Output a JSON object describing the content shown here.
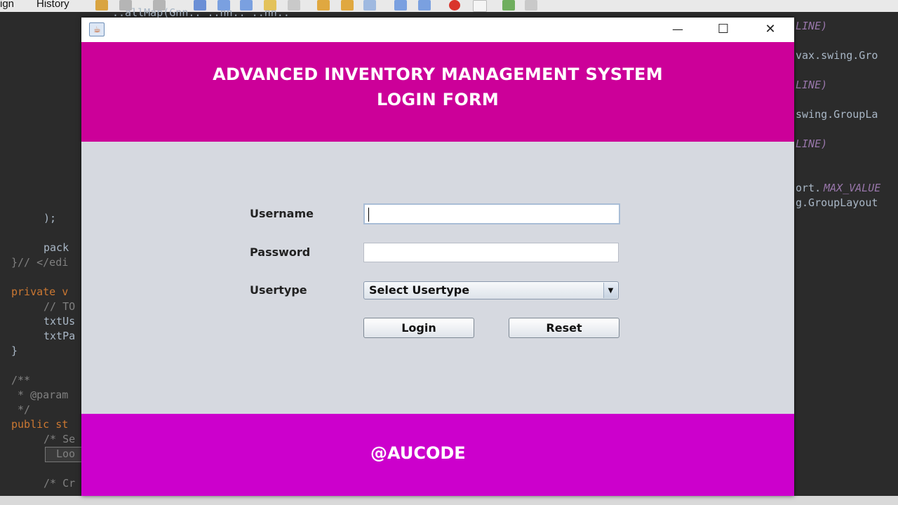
{
  "ide": {
    "menu": [
      "ign",
      "History"
    ],
    "code_left": {
      "l1": ");",
      "l2": "pack",
      "l3": "}// </edi",
      "l4_kw": "private v",
      "l5": "// TO",
      "l6": "txtUs",
      "l7": "txtPa",
      "l8": "}",
      "l9": "/**",
      "l10": " * @param",
      "l11": " */",
      "l12_kw": "public st",
      "l13": "/* Se",
      "l14": "Loo",
      "l15": "/* Cr"
    },
    "code_top": "..allMap(Gnn.. ..nn.. ..nn..",
    "code_right": {
      "r1": "LINE)",
      "r2": "vax.swing.Gro",
      "r3": "LINE)",
      "r4": "swing.GroupLa",
      "r5": "LINE)",
      "r6a": "ort.",
      "r6b": "MAX_VALUE",
      "r7": "g.GroupLayout"
    }
  },
  "window": {
    "icon": "java-coffee-icon",
    "controls": {
      "minimize": "—",
      "maximize": "☐",
      "close": "✕"
    },
    "header": {
      "line1": "ADVANCED INVENTORY MANAGEMENT SYSTEM",
      "line2": "LOGIN FORM"
    },
    "form": {
      "username_label": "Username",
      "username_value": "",
      "password_label": "Password",
      "password_value": "",
      "usertype_label": "Usertype",
      "usertype_selected": "Select Usertype",
      "login_button": "Login",
      "reset_button": "Reset"
    },
    "footer": "@AUCODE"
  },
  "colors": {
    "header_bg": "#cc0099",
    "footer_bg": "#cc00cc",
    "form_bg": "#d6d9e0"
  }
}
